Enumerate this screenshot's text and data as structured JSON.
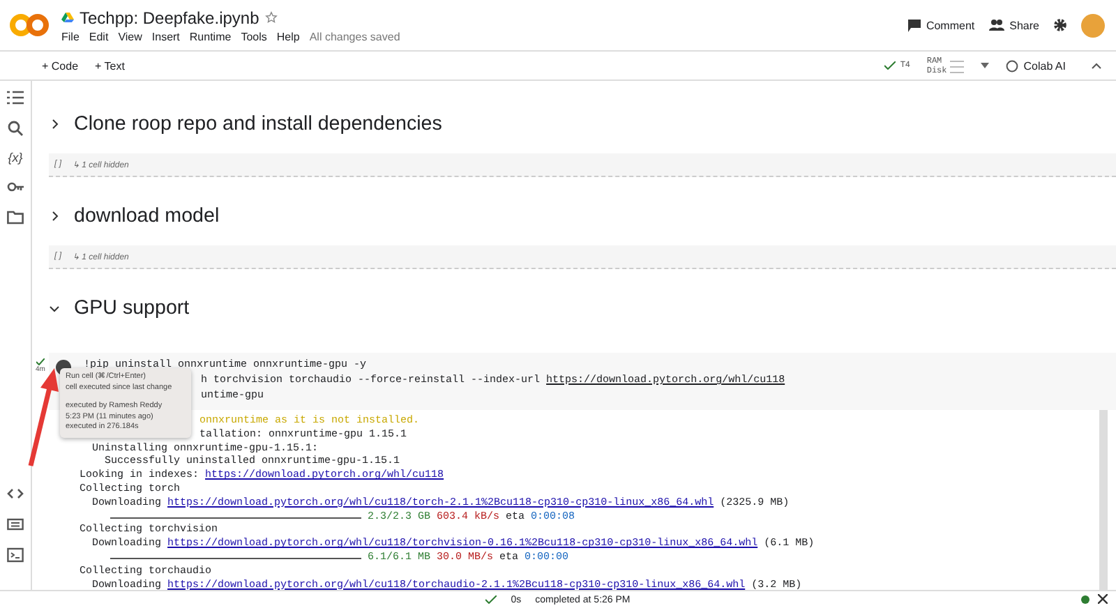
{
  "header": {
    "title": "Techpp: Deepfake.ipynb",
    "menu": [
      "File",
      "Edit",
      "View",
      "Insert",
      "Runtime",
      "Tools",
      "Help"
    ],
    "save_status": "All changes saved",
    "comment": "Comment",
    "share": "Share"
  },
  "toolbar": {
    "add_code": "+ Code",
    "add_text": "+ Text",
    "runtime": "T4",
    "ram": "RAM",
    "disk": "Disk",
    "colab_ai": "Colab AI"
  },
  "sidebar": {
    "variables": "{x}"
  },
  "sections": [
    {
      "title": "Clone roop repo and install dependencies",
      "expanded": false,
      "hidden_cells": "↳ 1 cell hidden",
      "brackets": "[ ]"
    },
    {
      "title": "download model",
      "expanded": false,
      "hidden_cells": "↳ 1 cell hidden",
      "brackets": "[ ]"
    },
    {
      "title": "GPU support",
      "expanded": true
    }
  ],
  "cell": {
    "run_time": "4m",
    "code_lines": [
      {
        "text": "!pip uninstall onnxruntime onnxruntime-gpu -y",
        "partly_hidden": false
      },
      {
        "text": "h torchvision torchaudio --force-reinstall --index-url ",
        "link": "https://download.pytorch.org/whl/cu118",
        "partly_hidden": true
      },
      {
        "text": "untime-gpu",
        "partly_hidden": true
      }
    ],
    "tooltip": {
      "hint": [
        "Run cell (⌘/Ctrl+Enter)",
        "cell executed since last change"
      ],
      "details": [
        "executed by Ramesh Reddy",
        "5:23 PM (11 minutes ago)",
        "executed in 276.184s"
      ]
    },
    "output": [
      {
        "kind": "warning",
        "text": "onnxruntime as it is not installed.",
        "partly_hidden": true
      },
      {
        "kind": "text",
        "text": "tallation: onnxruntime-gpu 1.15.1",
        "partly_hidden": true
      },
      {
        "kind": "text",
        "text": "  Uninstalling onnxruntime-gpu-1.15.1:",
        "partly_hidden": false
      },
      {
        "kind": "text",
        "text": "    Successfully uninstalled onnxruntime-gpu-1.15.1",
        "partly_hidden": false
      },
      {
        "kind": "text",
        "text": "Looking in indexes: ",
        "link": "https://download.pytorch.org/whl/cu118",
        "partly_hidden": false
      },
      {
        "kind": "text",
        "text": "Collecting torch",
        "partly_hidden": false
      },
      {
        "kind": "text",
        "text": "  Downloading ",
        "link": "https://download.pytorch.org/whl/cu118/torch-2.1.1%2Bcu118-cp310-cp310-linux_x86_64.whl",
        "after": " (2325.9 MB)",
        "partly_hidden": false
      },
      {
        "kind": "progress",
        "level": 1,
        "amount": "2.3/2.3 GB",
        "speed": "603.4 kB/s",
        "eta_label": "eta",
        "eta": "0:00:08"
      },
      {
        "kind": "text",
        "text": "Collecting torchvision",
        "partly_hidden": false
      },
      {
        "kind": "text",
        "text": "  Downloading ",
        "link": "https://download.pytorch.org/whl/cu118/torchvision-0.16.1%2Bcu118-cp310-cp310-linux_x86_64.whl",
        "after": " (6.1 MB)",
        "partly_hidden": false
      },
      {
        "kind": "progress",
        "level": 1,
        "amount": "6.1/6.1 MB",
        "speed": "30.0 MB/s",
        "eta_label": "eta",
        "eta": "0:00:00"
      },
      {
        "kind": "text",
        "text": "Collecting torchaudio",
        "partly_hidden": false
      },
      {
        "kind": "text",
        "text": "  Downloading ",
        "link": "https://download.pytorch.org/whl/cu118/torchaudio-2.1.1%2Bcu118-cp310-cp310-linux_x86_64.whl",
        "after": " (3.2 MB)",
        "partly_hidden": false
      }
    ]
  },
  "status_bar": {
    "duration": "0s",
    "completed": "completed at 5:26 PM"
  }
}
